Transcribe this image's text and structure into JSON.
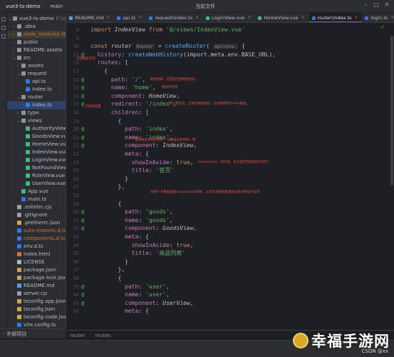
{
  "titlebar": {
    "project": "vue3-ts-demo",
    "branch": "main",
    "config": "当前文件"
  },
  "sidebar": {
    "items": [
      {
        "label": "vue3-ts-demo",
        "suffix": "E:\\web",
        "indent": 0,
        "caret": "v",
        "icon": "folder",
        "excluded": false
      },
      {
        "label": ".idea",
        "indent": 1,
        "caret": ">",
        "icon": "folder",
        "excluded": false
      },
      {
        "label": "node_modules library",
        "indent": 1,
        "caret": ">",
        "icon": "folder",
        "excluded": true,
        "highlight": true
      },
      {
        "label": "public",
        "indent": 1,
        "caret": ">",
        "icon": "folder",
        "excluded": false
      },
      {
        "label": "README.assets",
        "indent": 1,
        "caret": ">",
        "icon": "folder",
        "excluded": false
      },
      {
        "label": "src",
        "indent": 1,
        "caret": "v",
        "icon": "folder",
        "excluded": false
      },
      {
        "label": "assets",
        "indent": 2,
        "caret": ">",
        "icon": "folder",
        "excluded": false
      },
      {
        "label": "request",
        "indent": 2,
        "caret": "v",
        "icon": "folder",
        "excluded": false
      },
      {
        "label": "api.ts",
        "indent": 3,
        "caret": "",
        "icon": "ts",
        "excluded": false
      },
      {
        "label": "index.ts",
        "indent": 3,
        "caret": "",
        "icon": "ts",
        "excluded": false
      },
      {
        "label": "router",
        "indent": 2,
        "caret": "v",
        "icon": "folder",
        "excluded": false
      },
      {
        "label": "index.ts",
        "indent": 3,
        "caret": "",
        "icon": "ts",
        "excluded": false,
        "selected": true
      },
      {
        "label": "type",
        "indent": 2,
        "caret": ">",
        "icon": "folder",
        "excluded": false
      },
      {
        "label": "views",
        "indent": 2,
        "caret": "v",
        "icon": "folder",
        "excluded": false
      },
      {
        "label": "AuthorityView",
        "indent": 3,
        "caret": "",
        "icon": "vue",
        "excluded": false
      },
      {
        "label": "GoodsView.vue",
        "indent": 3,
        "caret": "",
        "icon": "vue",
        "excluded": false
      },
      {
        "label": "HomeView.vue",
        "indent": 3,
        "caret": "",
        "icon": "vue",
        "excluded": false
      },
      {
        "label": "IndexView.vue",
        "indent": 3,
        "caret": "",
        "icon": "vue",
        "excluded": false
      },
      {
        "label": "LoginView.vue",
        "indent": 3,
        "caret": "",
        "icon": "vue",
        "excluded": false
      },
      {
        "label": "NotFoundView",
        "indent": 3,
        "caret": "",
        "icon": "vue",
        "excluded": false
      },
      {
        "label": "RoleView.vue",
        "indent": 3,
        "caret": "",
        "icon": "vue",
        "excluded": false
      },
      {
        "label": "UserView.vue",
        "indent": 3,
        "caret": "",
        "icon": "vue",
        "excluded": false
      },
      {
        "label": "App.vue",
        "indent": 2,
        "caret": "",
        "icon": "vue",
        "excluded": false
      },
      {
        "label": "main.ts",
        "indent": 2,
        "caret": "",
        "icon": "ts",
        "excluded": false
      },
      {
        "label": ".eslintrc.cjs",
        "indent": 1,
        "caret": "",
        "icon": "other",
        "excluded": false
      },
      {
        "label": ".gitignore",
        "indent": 1,
        "caret": "",
        "icon": "other",
        "excluded": false
      },
      {
        "label": ".prettierrc.json",
        "indent": 1,
        "caret": "",
        "icon": "json",
        "excluded": false
      },
      {
        "label": "auto-imports.d.ts",
        "indent": 1,
        "caret": "",
        "icon": "ts",
        "excluded": true
      },
      {
        "label": "components.d.ts",
        "indent": 1,
        "caret": "",
        "icon": "ts",
        "excluded": true
      },
      {
        "label": "env.d.ts",
        "indent": 1,
        "caret": "",
        "icon": "ts",
        "excluded": false
      },
      {
        "label": "index.html",
        "indent": 1,
        "caret": "",
        "icon": "html",
        "excluded": false
      },
      {
        "label": "LICENSE",
        "indent": 1,
        "caret": "",
        "icon": "lic",
        "excluded": false
      },
      {
        "label": "package.json",
        "indent": 1,
        "caret": "",
        "icon": "json",
        "excluded": false
      },
      {
        "label": "package-lock.json",
        "indent": 1,
        "caret": "",
        "icon": "json",
        "excluded": false
      },
      {
        "label": "README.md",
        "indent": 1,
        "caret": "",
        "icon": "md",
        "excluded": false
      },
      {
        "label": "server.cjs",
        "indent": 1,
        "caret": "",
        "icon": "other",
        "excluded": false
      },
      {
        "label": "tsconfig.app.json",
        "indent": 1,
        "caret": "",
        "icon": "json",
        "excluded": false
      },
      {
        "label": "tsconfig.json",
        "indent": 1,
        "caret": "",
        "icon": "json",
        "excluded": false
      },
      {
        "label": "tsconfig.node.json",
        "indent": 1,
        "caret": "",
        "icon": "json",
        "excluded": false
      },
      {
        "label": "vite.config.ts",
        "indent": 1,
        "caret": "",
        "icon": "ts",
        "excluded": false
      }
    ]
  },
  "tabs": [
    {
      "label": "README.md",
      "icon": "md",
      "active": false
    },
    {
      "label": "api.ts",
      "icon": "ts",
      "active": false
    },
    {
      "label": "request\\index.ts",
      "icon": "ts",
      "active": false
    },
    {
      "label": "LoginView.vue",
      "icon": "vue",
      "active": false
    },
    {
      "label": "HomeView.vue",
      "icon": "vue",
      "active": false
    },
    {
      "label": "router\\index.ts",
      "icon": "ts",
      "active": true
    },
    {
      "label": "login.ts",
      "icon": "ts",
      "active": false
    }
  ],
  "code": {
    "lines": [
      {
        "n": "8",
        "tokens": [
          [
            "kw",
            "import "
          ],
          [
            "cls",
            "IndexView"
          ],
          [
            "kw",
            " from "
          ],
          [
            "str",
            "'@/views/IndexView.vue'"
          ]
        ]
      },
      {
        "n": "9",
        "tokens": []
      },
      {
        "n": "10",
        "tokens": [
          [
            "kw",
            "const "
          ],
          [
            "plain",
            "router "
          ],
          [
            "hint",
            "Router"
          ],
          [
            "plain",
            " = "
          ],
          [
            "fn",
            "createRouter"
          ],
          [
            "plain",
            "( "
          ],
          [
            "hint",
            "options:"
          ],
          [
            "plain",
            " {"
          ]
        ]
      },
      {
        "n": "11",
        "tokens": [
          [
            "plain",
            "  "
          ],
          [
            "prop",
            "history"
          ],
          [
            "plain",
            ": "
          ],
          [
            "fn",
            "createWebHistory"
          ],
          [
            "plain",
            "(import.meta.env.BASE_URL),"
          ]
        ]
      },
      {
        "n": "12",
        "tokens": [
          [
            "plain",
            "  "
          ],
          [
            "prop",
            "routes"
          ],
          [
            "plain",
            ": ["
          ]
        ]
      },
      {
        "n": "13",
        "tokens": [
          [
            "plain",
            "    {"
          ]
        ]
      },
      {
        "n": "14",
        "tokens": [
          [
            "plain",
            "      "
          ],
          [
            "prop",
            "path"
          ],
          [
            "plain",
            ": "
          ],
          [
            "str",
            "'/'"
          ],
          [
            "plain",
            ","
          ]
        ]
      },
      {
        "n": "15",
        "tokens": [
          [
            "plain",
            "      "
          ],
          [
            "prop",
            "name"
          ],
          [
            "plain",
            ": "
          ],
          [
            "str",
            "'home'"
          ],
          [
            "plain",
            ","
          ]
        ]
      },
      {
        "n": "16",
        "tokens": [
          [
            "plain",
            "      "
          ],
          [
            "prop",
            "component"
          ],
          [
            "plain",
            ": "
          ],
          [
            "ital",
            "HomeView"
          ],
          [
            "plain",
            ","
          ]
        ]
      },
      {
        "n": "17",
        "tokens": [
          [
            "plain",
            "      "
          ],
          [
            "prop",
            "redirect"
          ],
          [
            "plain",
            ": "
          ],
          [
            "str",
            "'/index'"
          ],
          [
            "plain",
            ","
          ]
        ]
      },
      {
        "n": "18",
        "tokens": [
          [
            "plain",
            "      "
          ],
          [
            "prop",
            "children"
          ],
          [
            "plain",
            ": ["
          ]
        ]
      },
      {
        "n": "19",
        "tokens": [
          [
            "plain",
            "        {"
          ]
        ]
      },
      {
        "n": "20",
        "tokens": [
          [
            "plain",
            "          "
          ],
          [
            "prop",
            "path"
          ],
          [
            "plain",
            ": "
          ],
          [
            "str",
            "'index'"
          ],
          [
            "plain",
            ","
          ]
        ]
      },
      {
        "n": "21",
        "tokens": [
          [
            "plain",
            "          "
          ],
          [
            "prop",
            "name"
          ],
          [
            "plain",
            ": "
          ],
          [
            "str",
            "'index'"
          ],
          [
            "plain",
            ","
          ]
        ]
      },
      {
        "n": "22",
        "tokens": [
          [
            "plain",
            "          "
          ],
          [
            "prop",
            "component"
          ],
          [
            "plain",
            ": "
          ],
          [
            "ital",
            "IndexView"
          ],
          [
            "plain",
            ","
          ]
        ]
      },
      {
        "n": "23",
        "tokens": [
          [
            "plain",
            "          "
          ],
          [
            "prop",
            "meta"
          ],
          [
            "plain",
            ": {"
          ]
        ]
      },
      {
        "n": "24",
        "tokens": [
          [
            "plain",
            "            "
          ],
          [
            "prop",
            "showInAside"
          ],
          [
            "plain",
            ": "
          ],
          [
            "kw",
            "true"
          ],
          [
            "plain",
            ","
          ]
        ]
      },
      {
        "n": "25",
        "tokens": [
          [
            "plain",
            "            "
          ],
          [
            "prop",
            "title"
          ],
          [
            "plain",
            ": "
          ],
          [
            "str",
            "'首页'"
          ]
        ]
      },
      {
        "n": "26",
        "tokens": [
          [
            "plain",
            "          }"
          ]
        ]
      },
      {
        "n": "27",
        "tokens": [
          [
            "plain",
            "        },"
          ]
        ]
      },
      {
        "n": "28",
        "tokens": []
      },
      {
        "n": "29",
        "tokens": [
          [
            "plain",
            "        {"
          ]
        ]
      },
      {
        "n": "30",
        "tokens": [
          [
            "plain",
            "          "
          ],
          [
            "prop",
            "path"
          ],
          [
            "plain",
            ": "
          ],
          [
            "str",
            "'goods'"
          ],
          [
            "plain",
            ","
          ]
        ]
      },
      {
        "n": "31",
        "tokens": [
          [
            "plain",
            "          "
          ],
          [
            "prop",
            "name"
          ],
          [
            "plain",
            ": "
          ],
          [
            "str",
            "'goods'"
          ],
          [
            "plain",
            ","
          ]
        ]
      },
      {
        "n": "32",
        "tokens": [
          [
            "plain",
            "          "
          ],
          [
            "prop",
            "component"
          ],
          [
            "plain",
            ": "
          ],
          [
            "ital",
            "GoodsView"
          ],
          [
            "plain",
            ","
          ]
        ]
      },
      {
        "n": "33",
        "tokens": [
          [
            "plain",
            "          "
          ],
          [
            "prop",
            "meta"
          ],
          [
            "plain",
            ": {"
          ]
        ]
      },
      {
        "n": "34",
        "tokens": [
          [
            "plain",
            "            "
          ],
          [
            "prop",
            "showInAside"
          ],
          [
            "plain",
            ": "
          ],
          [
            "kw",
            "true"
          ],
          [
            "plain",
            ","
          ]
        ]
      },
      {
        "n": "35",
        "tokens": [
          [
            "plain",
            "            "
          ],
          [
            "prop",
            "title"
          ],
          [
            "plain",
            ": "
          ],
          [
            "str",
            "'商品列表'"
          ]
        ]
      },
      {
        "n": "36",
        "tokens": [
          [
            "plain",
            "          }"
          ]
        ]
      },
      {
        "n": "37",
        "tokens": [
          [
            "plain",
            "        },"
          ]
        ]
      },
      {
        "n": "38",
        "tokens": [
          [
            "plain",
            "        {"
          ]
        ]
      },
      {
        "n": "39",
        "tokens": [
          [
            "plain",
            "          "
          ],
          [
            "prop",
            "path"
          ],
          [
            "plain",
            ": "
          ],
          [
            "str",
            "'user'"
          ],
          [
            "plain",
            ","
          ]
        ]
      },
      {
        "n": "40",
        "tokens": [
          [
            "plain",
            "          "
          ],
          [
            "prop",
            "name"
          ],
          [
            "plain",
            ": "
          ],
          [
            "str",
            "'user'"
          ],
          [
            "plain",
            ","
          ]
        ]
      },
      {
        "n": "41",
        "tokens": [
          [
            "plain",
            "          "
          ],
          [
            "prop",
            "component"
          ],
          [
            "plain",
            ": "
          ],
          [
            "ital",
            "UserView"
          ],
          [
            "plain",
            ","
          ]
        ]
      },
      {
        "n": "42",
        "tokens": [
          [
            "plain",
            "          "
          ],
          [
            "prop",
            "meta"
          ],
          [
            "plain",
            ": {"
          ]
        ]
      }
    ],
    "gutter_marks": [
      {
        "line": "11",
        "mark": "@"
      },
      {
        "line": "14",
        "mark": "@"
      },
      {
        "line": "15",
        "mark": "@"
      },
      {
        "line": "16",
        "mark": "@"
      },
      {
        "line": "17",
        "mark": "@"
      },
      {
        "line": "20",
        "mark": "@"
      },
      {
        "line": "21",
        "mark": "@"
      },
      {
        "line": "22",
        "mark": "@"
      },
      {
        "line": "30",
        "mark": "@"
      },
      {
        "line": "31",
        "mark": "@"
      },
      {
        "line": "32",
        "mark": "@"
      },
      {
        "line": "39",
        "mark": "@"
      },
      {
        "line": "40",
        "mark": "@"
      },
      {
        "line": "41",
        "mark": "@"
      }
    ],
    "annotations": [
      {
        "text": "创建路由实例",
        "line": "11"
      },
      {
        "text": "路由规则，这里指定根路由地址。",
        "line": "14"
      },
      {
        "text": "路由的名称",
        "line": "15"
      },
      {
        "text": "默认重定向，当访问根路由时，自动跳转到/index路由。",
        "line": "17"
      },
      {
        "text": "子路由配置",
        "line": "18"
      },
      {
        "text": "当前路由对应的组件，与路由名称保持一致",
        "line": "22"
      },
      {
        "text": "showInAside：布尔值，标记是否在侧边栏中显示",
        "line": "24"
      },
      {
        "text": "对每个子路由配置showInAside属性，从而实现根据配置动态生成侧边栏菜单",
        "line": "28"
      }
    ]
  },
  "breadcrumb": [
    "router",
    "routes"
  ],
  "bottom": {
    "label": "外部项目"
  },
  "watermark": {
    "text": "幸福手游网",
    "sub": "CSDN @xx"
  },
  "colors": {
    "accent": "#3574f0",
    "keyword": "#cf8e6d",
    "string": "#6aab73",
    "property": "#c77dbb",
    "function": "#56a8f5",
    "annotation": "#e5484d"
  }
}
